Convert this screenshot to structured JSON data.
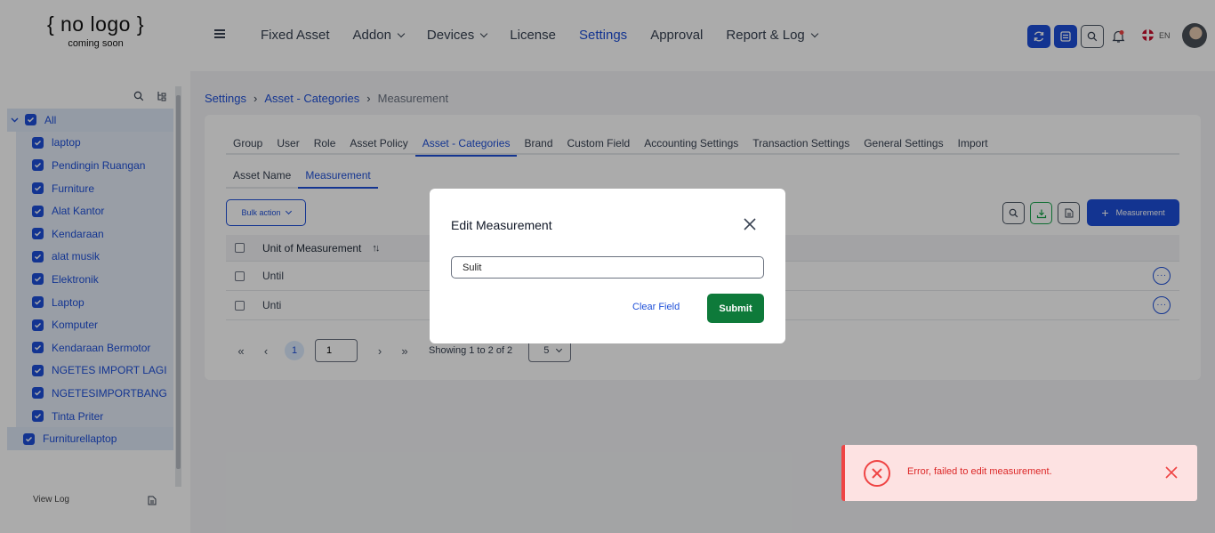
{
  "logo": {
    "line1": "{ no logo }",
    "line2": "coming soon"
  },
  "nav": [
    {
      "label": "Fixed Asset",
      "dropdown": false,
      "active": false
    },
    {
      "label": "Addon",
      "dropdown": true,
      "active": false
    },
    {
      "label": "Devices",
      "dropdown": true,
      "active": false
    },
    {
      "label": "License",
      "dropdown": false,
      "active": false
    },
    {
      "label": "Settings",
      "dropdown": false,
      "active": true
    },
    {
      "label": "Approval",
      "dropdown": false,
      "active": false
    },
    {
      "label": "Report & Log",
      "dropdown": true,
      "active": false
    }
  ],
  "header": {
    "lang": "EN"
  },
  "sidebar": {
    "root_label": "All",
    "items": [
      "laptop",
      "Pendingin Ruangan",
      "Furniture",
      "Alat Kantor",
      "Kendaraan",
      "alat musik",
      "Elektronik",
      "Laptop",
      "Komputer",
      "Kendaraan Bermotor",
      "NGETES IMPORT LAGI",
      "NGETESIMPORTBANG",
      "Tinta Priter"
    ],
    "last_root": "Furniturellaptop",
    "view_log": "View Log"
  },
  "breadcrumb": {
    "item1": "Settings",
    "item2": "Asset - Categories",
    "current": "Measurement"
  },
  "tabs": [
    {
      "label": "Group",
      "active": false
    },
    {
      "label": "User",
      "active": false
    },
    {
      "label": "Role",
      "active": false
    },
    {
      "label": "Asset Policy",
      "active": false
    },
    {
      "label": "Asset - Categories",
      "active": true
    },
    {
      "label": "Brand",
      "active": false
    },
    {
      "label": "Custom Field",
      "active": false
    },
    {
      "label": "Accounting Settings",
      "active": false
    },
    {
      "label": "Transaction Settings",
      "active": false
    },
    {
      "label": "General Settings",
      "active": false
    },
    {
      "label": "Import",
      "active": false
    }
  ],
  "subtabs": [
    {
      "label": "Asset Name",
      "active": false
    },
    {
      "label": "Measurement",
      "active": true
    }
  ],
  "toolbar": {
    "bulk_label": "Bulk action",
    "add_label": "Measurement"
  },
  "table": {
    "header": "Unit of Measurement",
    "sort_icon": "↑↓",
    "rows": [
      {
        "unit": "Until"
      },
      {
        "unit": "Unti"
      }
    ]
  },
  "pagination": {
    "current": "1",
    "input_value": "1",
    "showing": "Showing 1 to 2 of 2",
    "page_size": "5"
  },
  "modal": {
    "title": "Edit Measurement",
    "input_value": "Sulit",
    "clear_label": "Clear Field",
    "submit_label": "Submit"
  },
  "toast": {
    "message": "Error, failed to edit measurement."
  },
  "colors": {
    "primary": "#1d4ed8",
    "success": "#0e7a3a",
    "error": "#ef4444"
  }
}
